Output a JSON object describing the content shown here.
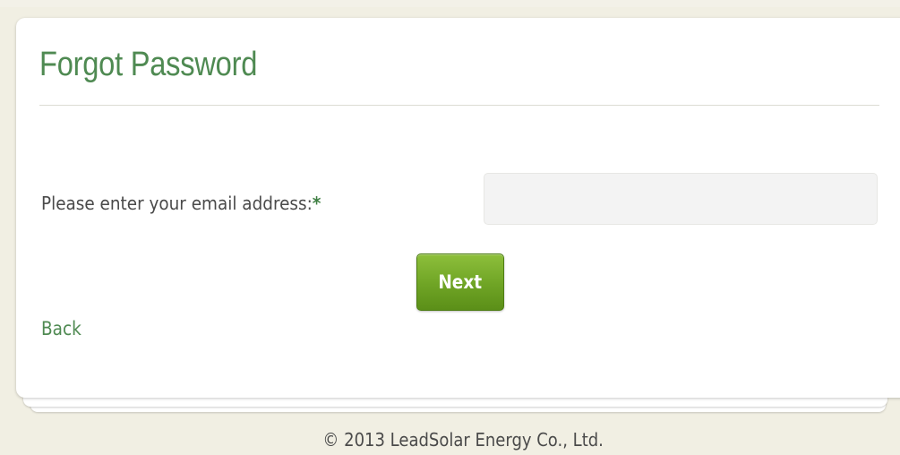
{
  "page": {
    "title": "Forgot Password"
  },
  "form": {
    "email_label": "Please enter your email address:",
    "required_marker": "*",
    "email_value": "",
    "next_label": "Next"
  },
  "nav": {
    "back_label": "Back"
  },
  "footer": {
    "copyright": "© 2013 LeadSolar Energy Co., Ltd."
  },
  "colors": {
    "accent_green": "#4f8a52",
    "button_green": "#6fa425",
    "page_background": "#f1efe3"
  }
}
